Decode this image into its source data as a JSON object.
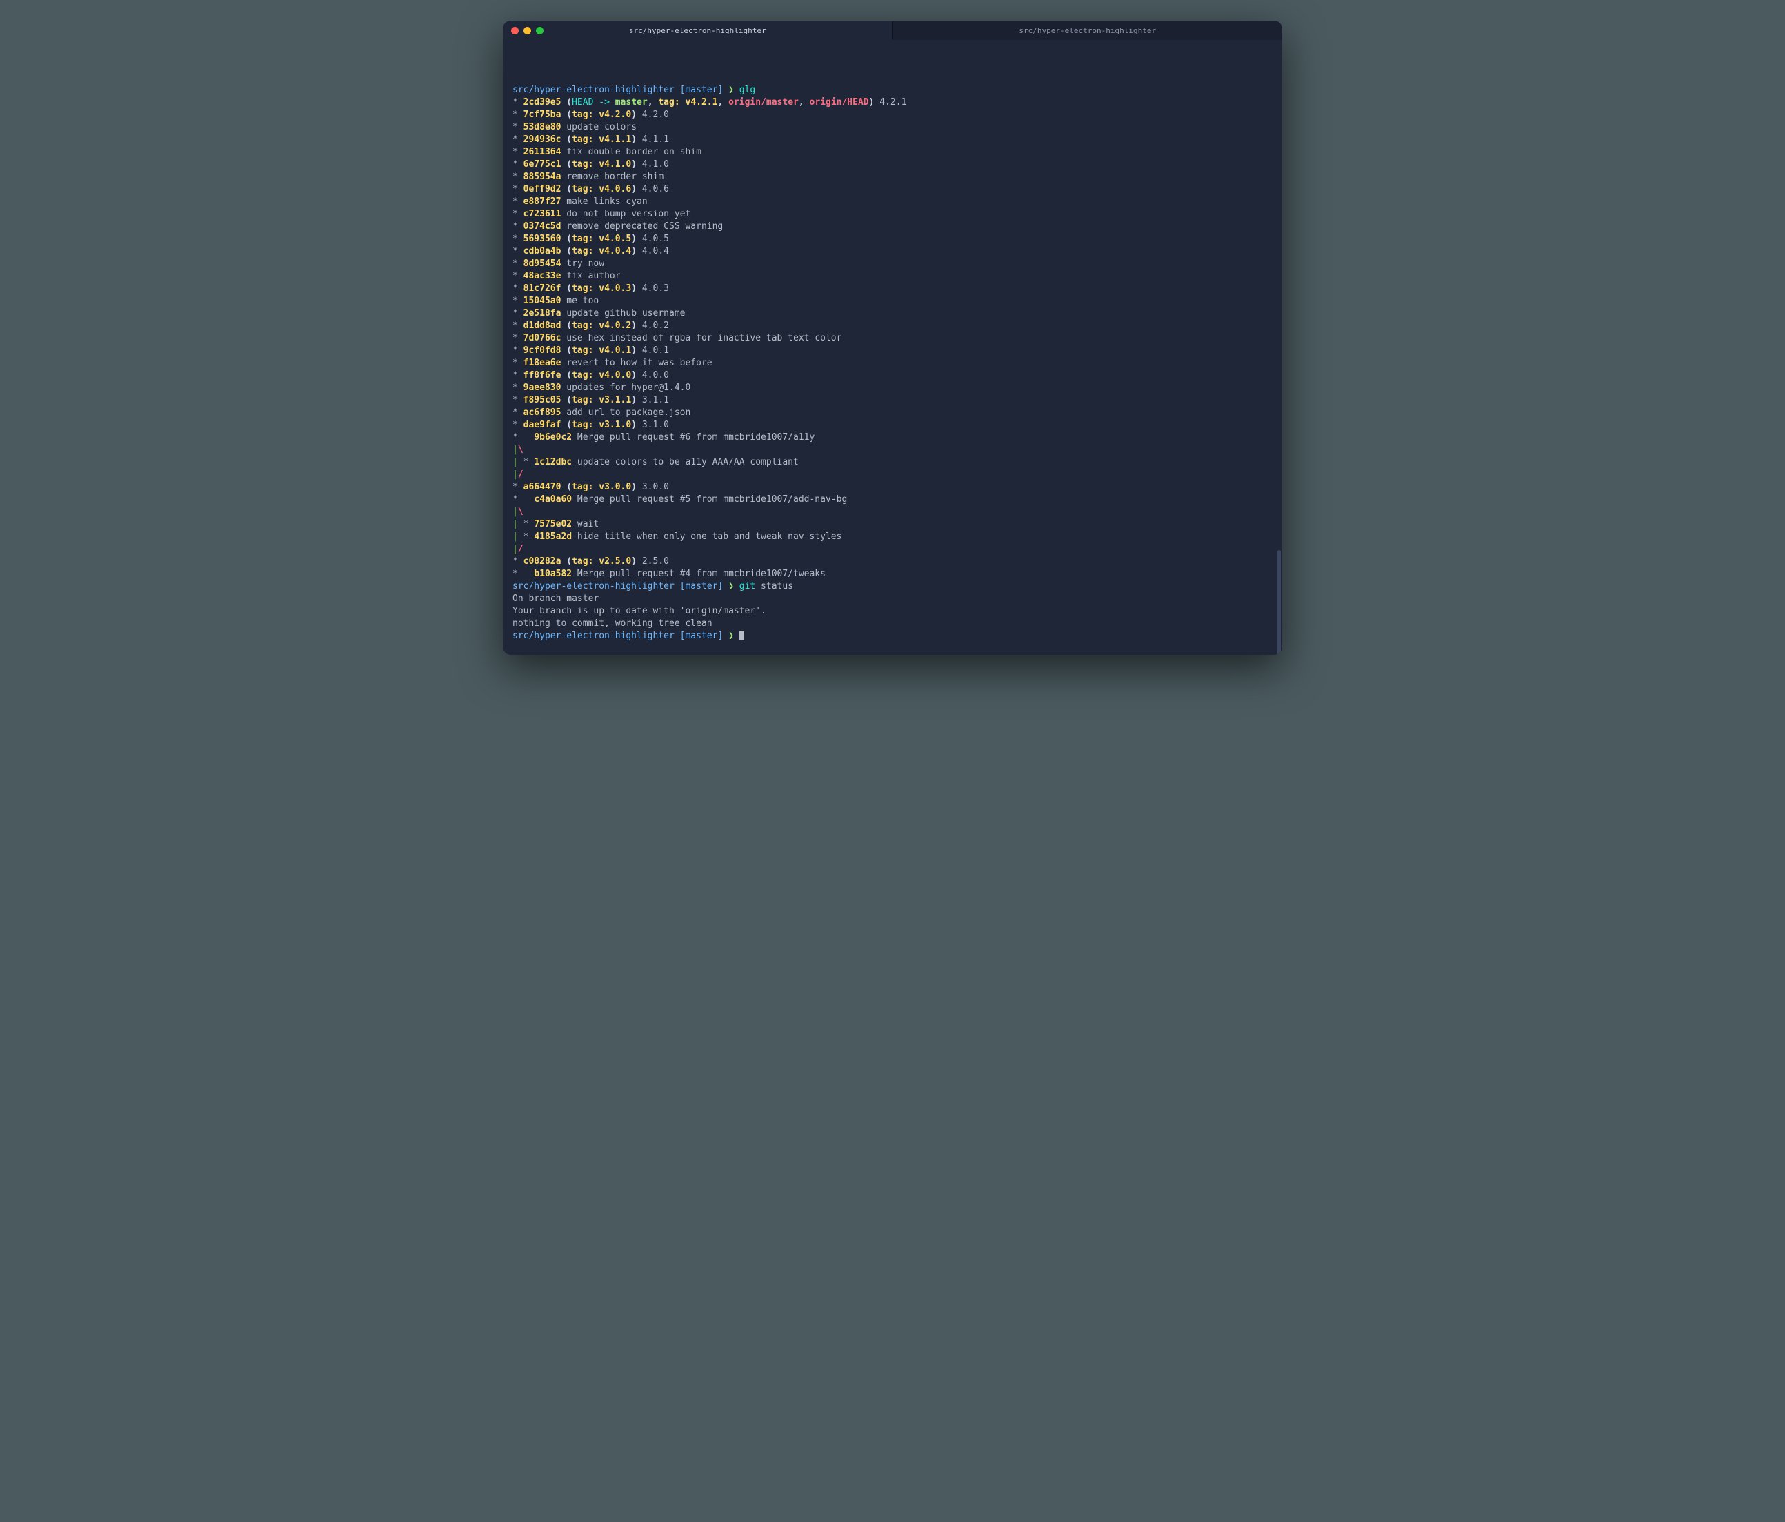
{
  "tabs": [
    {
      "title": "src/hyper-electron-highlighter",
      "active": true
    },
    {
      "title": "src/hyper-electron-highlighter",
      "active": false
    }
  ],
  "prompt": {
    "path": "src/hyper-electron-highlighter",
    "branch": "[master]",
    "caret": "❯"
  },
  "commands": {
    "glg": "glg",
    "git": "git",
    "status": "status"
  },
  "head_refs": {
    "head_arrow": "HEAD -> ",
    "master": "master",
    "tag_prefix": "tag: ",
    "v421": "v4.2.1",
    "origin_master": "origin/master",
    "origin_head": "origin/HEAD"
  },
  "log": [
    {
      "g": "* ",
      "sha": "2cd39e5",
      "special": "head",
      "msg": " 4.2.1"
    },
    {
      "g": "* ",
      "sha": "7cf75ba",
      "tag": "v4.2.0",
      "msg": " 4.2.0"
    },
    {
      "g": "* ",
      "sha": "53d8e80",
      "msg": " update colors"
    },
    {
      "g": "* ",
      "sha": "294936c",
      "tag": "v4.1.1",
      "msg": " 4.1.1"
    },
    {
      "g": "* ",
      "sha": "2611364",
      "msg": " fix double border on shim"
    },
    {
      "g": "* ",
      "sha": "6e775c1",
      "tag": "v4.1.0",
      "msg": " 4.1.0"
    },
    {
      "g": "* ",
      "sha": "885954a",
      "msg": " remove border shim"
    },
    {
      "g": "* ",
      "sha": "0eff9d2",
      "tag": "v4.0.6",
      "msg": " 4.0.6"
    },
    {
      "g": "* ",
      "sha": "e887f27",
      "msg": " make links cyan"
    },
    {
      "g": "* ",
      "sha": "c723611",
      "msg": " do not bump version yet"
    },
    {
      "g": "* ",
      "sha": "0374c5d",
      "msg": " remove deprecated CSS warning"
    },
    {
      "g": "* ",
      "sha": "5693560",
      "tag": "v4.0.5",
      "msg": " 4.0.5"
    },
    {
      "g": "* ",
      "sha": "cdb0a4b",
      "tag": "v4.0.4",
      "msg": " 4.0.4"
    },
    {
      "g": "* ",
      "sha": "8d95454",
      "msg": " try now"
    },
    {
      "g": "* ",
      "sha": "48ac33e",
      "msg": " fix author"
    },
    {
      "g": "* ",
      "sha": "81c726f",
      "tag": "v4.0.3",
      "msg": " 4.0.3"
    },
    {
      "g": "* ",
      "sha": "15045a0",
      "msg": " me too"
    },
    {
      "g": "* ",
      "sha": "2e518fa",
      "msg": " update github username"
    },
    {
      "g": "* ",
      "sha": "d1dd8ad",
      "tag": "v4.0.2",
      "msg": " 4.0.2"
    },
    {
      "g": "* ",
      "sha": "7d0766c",
      "msg": " use hex instead of rgba for inactive tab text color"
    },
    {
      "g": "* ",
      "sha": "9cf0fd8",
      "tag": "v4.0.1",
      "msg": " 4.0.1"
    },
    {
      "g": "* ",
      "sha": "f18ea6e",
      "msg": " revert to how it was before"
    },
    {
      "g": "* ",
      "sha": "ff8f6fe",
      "tag": "v4.0.0",
      "msg": " 4.0.0"
    },
    {
      "g": "* ",
      "sha": "9aee830",
      "msg": " updates for hyper@1.4.0"
    },
    {
      "g": "* ",
      "sha": "f895c05",
      "tag": "v3.1.1",
      "msg": " 3.1.1"
    },
    {
      "g": "* ",
      "sha": "ac6f895",
      "msg": " add url to package.json"
    },
    {
      "g": "* ",
      "sha": "dae9faf",
      "tag": "v3.1.0",
      "msg": " 3.1.0"
    },
    {
      "g": "*   ",
      "sha": "9b6e0c2",
      "msg": " Merge pull request #6 from mmcbride1007/a11y"
    },
    {
      "graph_only": "|\\"
    },
    {
      "g": "| * ",
      "sha": "1c12dbc",
      "msg": " update colors to be a11y AAA/AA compliant"
    },
    {
      "graph_only": "|/"
    },
    {
      "g": "* ",
      "sha": "a664470",
      "tag": "v3.0.0",
      "msg": " 3.0.0"
    },
    {
      "g": "*   ",
      "sha": "c4a0a60",
      "msg": " Merge pull request #5 from mmcbride1007/add-nav-bg"
    },
    {
      "graph_only": "|\\"
    },
    {
      "g": "| * ",
      "sha": "7575e02",
      "msg": " wait"
    },
    {
      "g": "| * ",
      "sha": "4185a2d",
      "msg": " hide title when only one tab and tweak nav styles"
    },
    {
      "graph_only": "|/"
    },
    {
      "g": "* ",
      "sha": "c08282a",
      "tag": "v2.5.0",
      "msg": " 2.5.0"
    },
    {
      "g": "*   ",
      "sha": "b10a582",
      "msg": " Merge pull request #4 from mmcbride1007/tweaks"
    }
  ],
  "status": {
    "line1": "On branch master",
    "line2": "Your branch is up to date with 'origin/master'.",
    "line3": "nothing to commit, working tree clean"
  }
}
